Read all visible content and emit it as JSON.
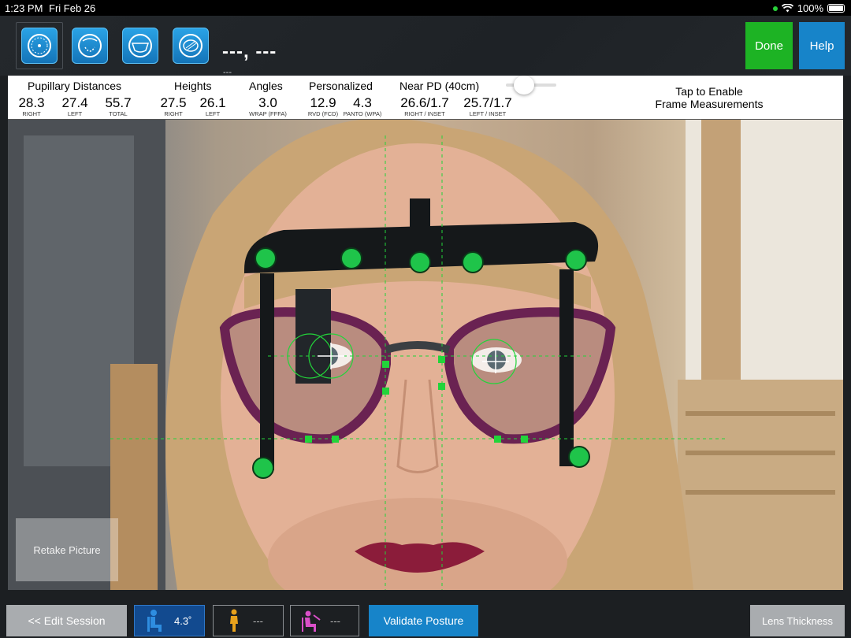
{
  "status_bar": {
    "time": "1:23 PM",
    "date": "Fri Feb 26",
    "battery": "100%"
  },
  "toolbar": {
    "mode_buttons": [
      {
        "icon": "single-vision-lens-icon"
      },
      {
        "icon": "progressive-lens-icon"
      },
      {
        "icon": "frame-lens-icon"
      },
      {
        "icon": "coated-lens-icon"
      }
    ],
    "session_name": "---, ---",
    "session_sub": "---",
    "done_label": "Done",
    "help_label": "Help"
  },
  "measurements": {
    "pd": {
      "title": "Pupillary Distances",
      "right": "28.3",
      "left": "27.4",
      "total": "55.7",
      "cap_right": "RIGHT",
      "cap_left": "LEFT",
      "cap_total": "TOTAL"
    },
    "heights": {
      "title": "Heights",
      "right": "27.5",
      "left": "26.1",
      "cap_right": "RIGHT",
      "cap_left": "LEFT"
    },
    "angles": {
      "title": "Angles",
      "wrap": "3.0",
      "cap_wrap": "WRAP (FFFA)"
    },
    "personalized": {
      "title": "Personalized",
      "rvd": "12.9",
      "panto": "4.3",
      "cap_rvd": "RVD (FCD)",
      "cap_panto": "PANTO (WPA)"
    },
    "near_pd": {
      "title": "Near PD (40cm)",
      "right": "26.6/1.7",
      "left": "25.7/1.7",
      "cap_right": "RIGHT / INSET",
      "cap_left": "LEFT / INSET"
    },
    "frame_enable": "Tap to Enable\nFrame Measurements"
  },
  "photo": {
    "retake_label": "Retake Picture"
  },
  "bottom": {
    "edit_label": "<< Edit Session",
    "posture_tilt": "4.3˚",
    "posture_standing": "---",
    "posture_reading": "---",
    "validate_label": "Validate Posture",
    "lens_label": "Lens Thickness"
  },
  "colors": {
    "accent_blue": "#1784c9",
    "done_green": "#1db324",
    "overlay_green": "#22d43a"
  }
}
